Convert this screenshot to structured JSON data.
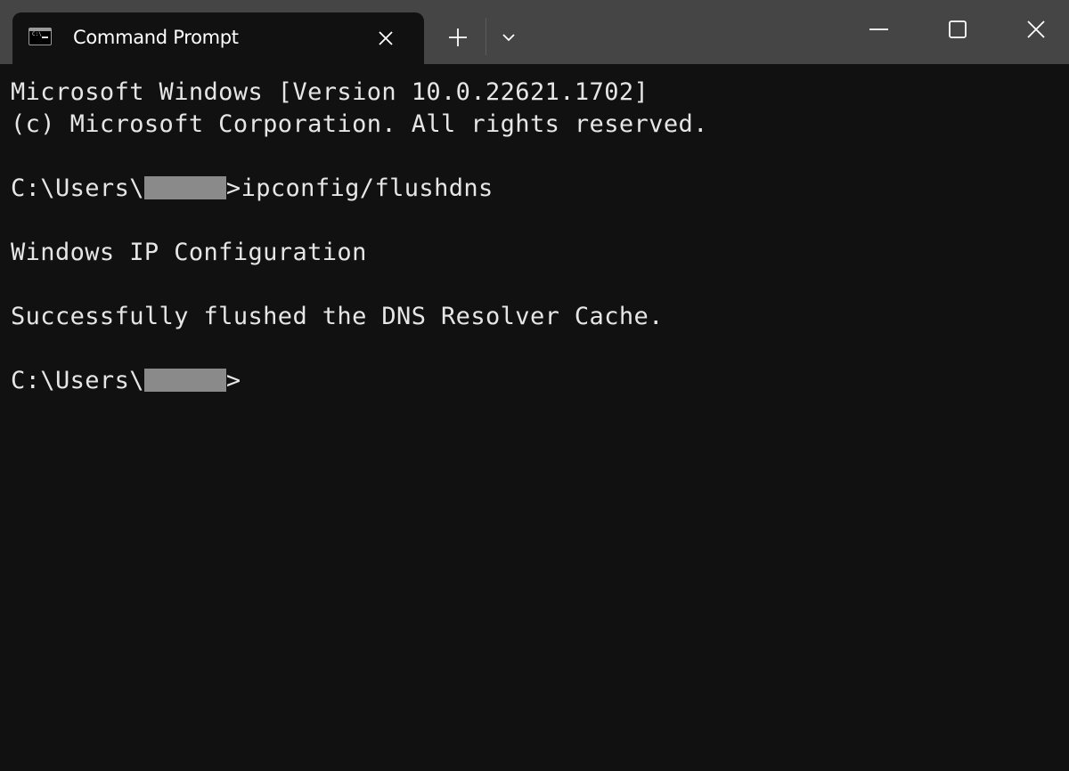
{
  "window": {
    "tab": {
      "title": "Command Prompt",
      "icon": "command-prompt-icon",
      "close_icon": "close-icon"
    },
    "new_tab_icon": "plus-icon",
    "dropdown_icon": "chevron-down-icon",
    "controls": {
      "minimize_icon": "minimize-icon",
      "maximize_icon": "maximize-icon",
      "close_icon": "close-icon"
    },
    "colors": {
      "titlebar": "#454545",
      "background": "#111111",
      "text": "#e6e6e6",
      "redaction": "#8a8a8a"
    }
  },
  "terminal": {
    "lines": [
      {
        "text": "Microsoft Windows [Version 10.0.22621.1702]"
      },
      {
        "text": "(c) Microsoft Corporation. All rights reserved."
      },
      {
        "text": ""
      },
      {
        "prompt_prefix": "C:\\Users\\",
        "redacted": true,
        "prompt_suffix": ">",
        "command": "ipconfig/flushdns"
      },
      {
        "text": ""
      },
      {
        "text": "Windows IP Configuration"
      },
      {
        "text": ""
      },
      {
        "text": "Successfully flushed the DNS Resolver Cache."
      },
      {
        "text": ""
      },
      {
        "prompt_prefix": "C:\\Users\\",
        "redacted": true,
        "prompt_suffix": ">",
        "command": ""
      }
    ]
  }
}
